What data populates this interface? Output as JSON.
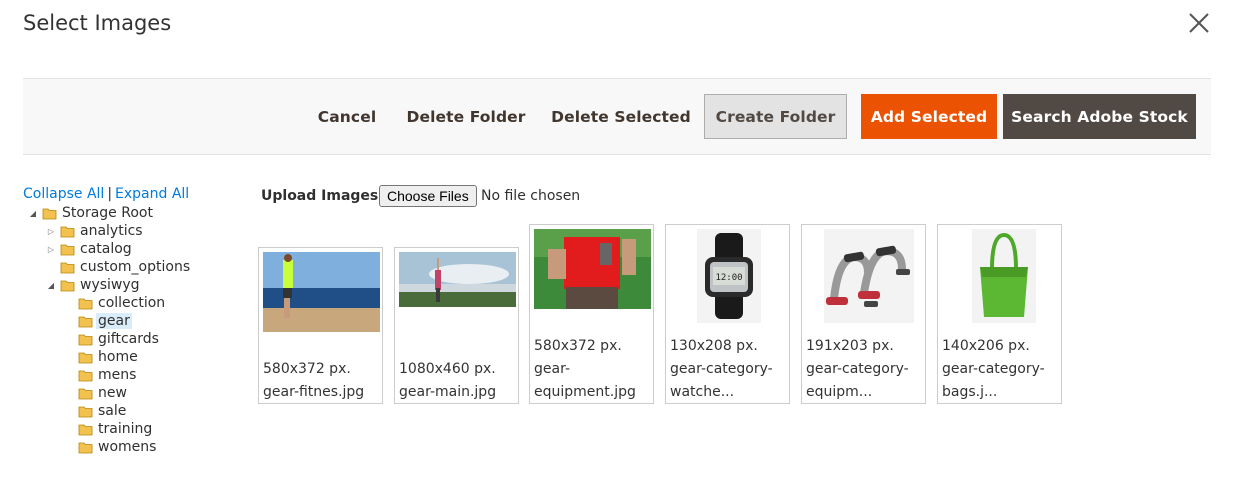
{
  "modal": {
    "title": "Select Images"
  },
  "toolbar": {
    "cancel": "Cancel",
    "delete_folder": "Delete Folder",
    "delete_selected": "Delete Selected",
    "create_folder": "Create Folder",
    "add_selected": "Add Selected",
    "search_stock": "Search Adobe Stock"
  },
  "tree": {
    "collapse_all": "Collapse All",
    "separator": "|",
    "expand_all": "Expand All",
    "nodes": [
      {
        "label": "Storage Root"
      },
      {
        "label": "analytics"
      },
      {
        "label": "catalog"
      },
      {
        "label": "custom_options"
      },
      {
        "label": "wysiwyg"
      },
      {
        "label": "collection"
      },
      {
        "label": "gear"
      },
      {
        "label": "giftcards"
      },
      {
        "label": "home"
      },
      {
        "label": "mens"
      },
      {
        "label": "new"
      },
      {
        "label": "sale"
      },
      {
        "label": "training"
      },
      {
        "label": "womens"
      }
    ]
  },
  "upload": {
    "label": "Upload Images",
    "choose_files": "Choose Files",
    "no_file": "No file chosen"
  },
  "images": [
    {
      "dims": "580x372 px.",
      "name_line1": "gear-fitnes.jpg",
      "name_line2": ""
    },
    {
      "dims": "1080x460 px.",
      "name_line1": "gear-main.jpg",
      "name_line2": ""
    },
    {
      "dims": "580x372 px.",
      "name_line1": "gear-",
      "name_line2": "equipment.jpg"
    },
    {
      "dims": "130x208 px.",
      "name_line1": "gear-category-",
      "name_line2": "watche..."
    },
    {
      "dims": "191x203 px.",
      "name_line1": "gear-category-",
      "name_line2": "equipm..."
    },
    {
      "dims": "140x206 px.",
      "name_line1": "gear-category-",
      "name_line2": "bags.j..."
    }
  ],
  "colors": {
    "primary": "#eb5202",
    "dark": "#514943",
    "link": "#007bdb",
    "selected_bg": "#d9ecfa"
  }
}
